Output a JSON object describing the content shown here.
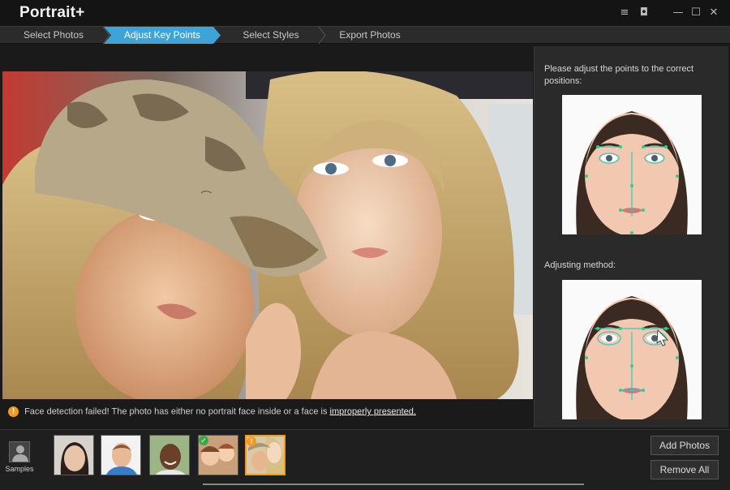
{
  "app": {
    "title": "Portrait+"
  },
  "window_controls": {
    "menu": "≡",
    "chat": "◘",
    "minimize": "—",
    "maximize": "☐",
    "close": "✕"
  },
  "steps": [
    {
      "label": "Select Photos",
      "active": false
    },
    {
      "label": "Adjust Key Points",
      "active": true
    },
    {
      "label": "Select Styles",
      "active": false
    },
    {
      "label": "Export Photos",
      "active": false
    }
  ],
  "notice": {
    "icon": "!",
    "text": "Face detection failed! The photo has either no portrait face inside or a face is ",
    "link": "improperly presented."
  },
  "right_panel": {
    "instruction": "Please adjust the points to the correct positions:",
    "method_label": "Adjusting method:"
  },
  "bottom": {
    "sample_label": "Samples",
    "add_photos": "Add Photos",
    "remove_all": "Remove All"
  },
  "thumbnails": [
    {
      "name": "asian-woman",
      "badge": "",
      "selected": false
    },
    {
      "name": "young-man",
      "badge": "",
      "selected": false
    },
    {
      "name": "smiling-man",
      "badge": "",
      "selected": false
    },
    {
      "name": "group-girls",
      "badge": "check",
      "selected": false
    },
    {
      "name": "two-blondes",
      "badge": "warning",
      "selected": true
    }
  ],
  "colors": {
    "accent": "#3ea3d6",
    "warning": "#f29b1c",
    "success": "#3aa845"
  }
}
